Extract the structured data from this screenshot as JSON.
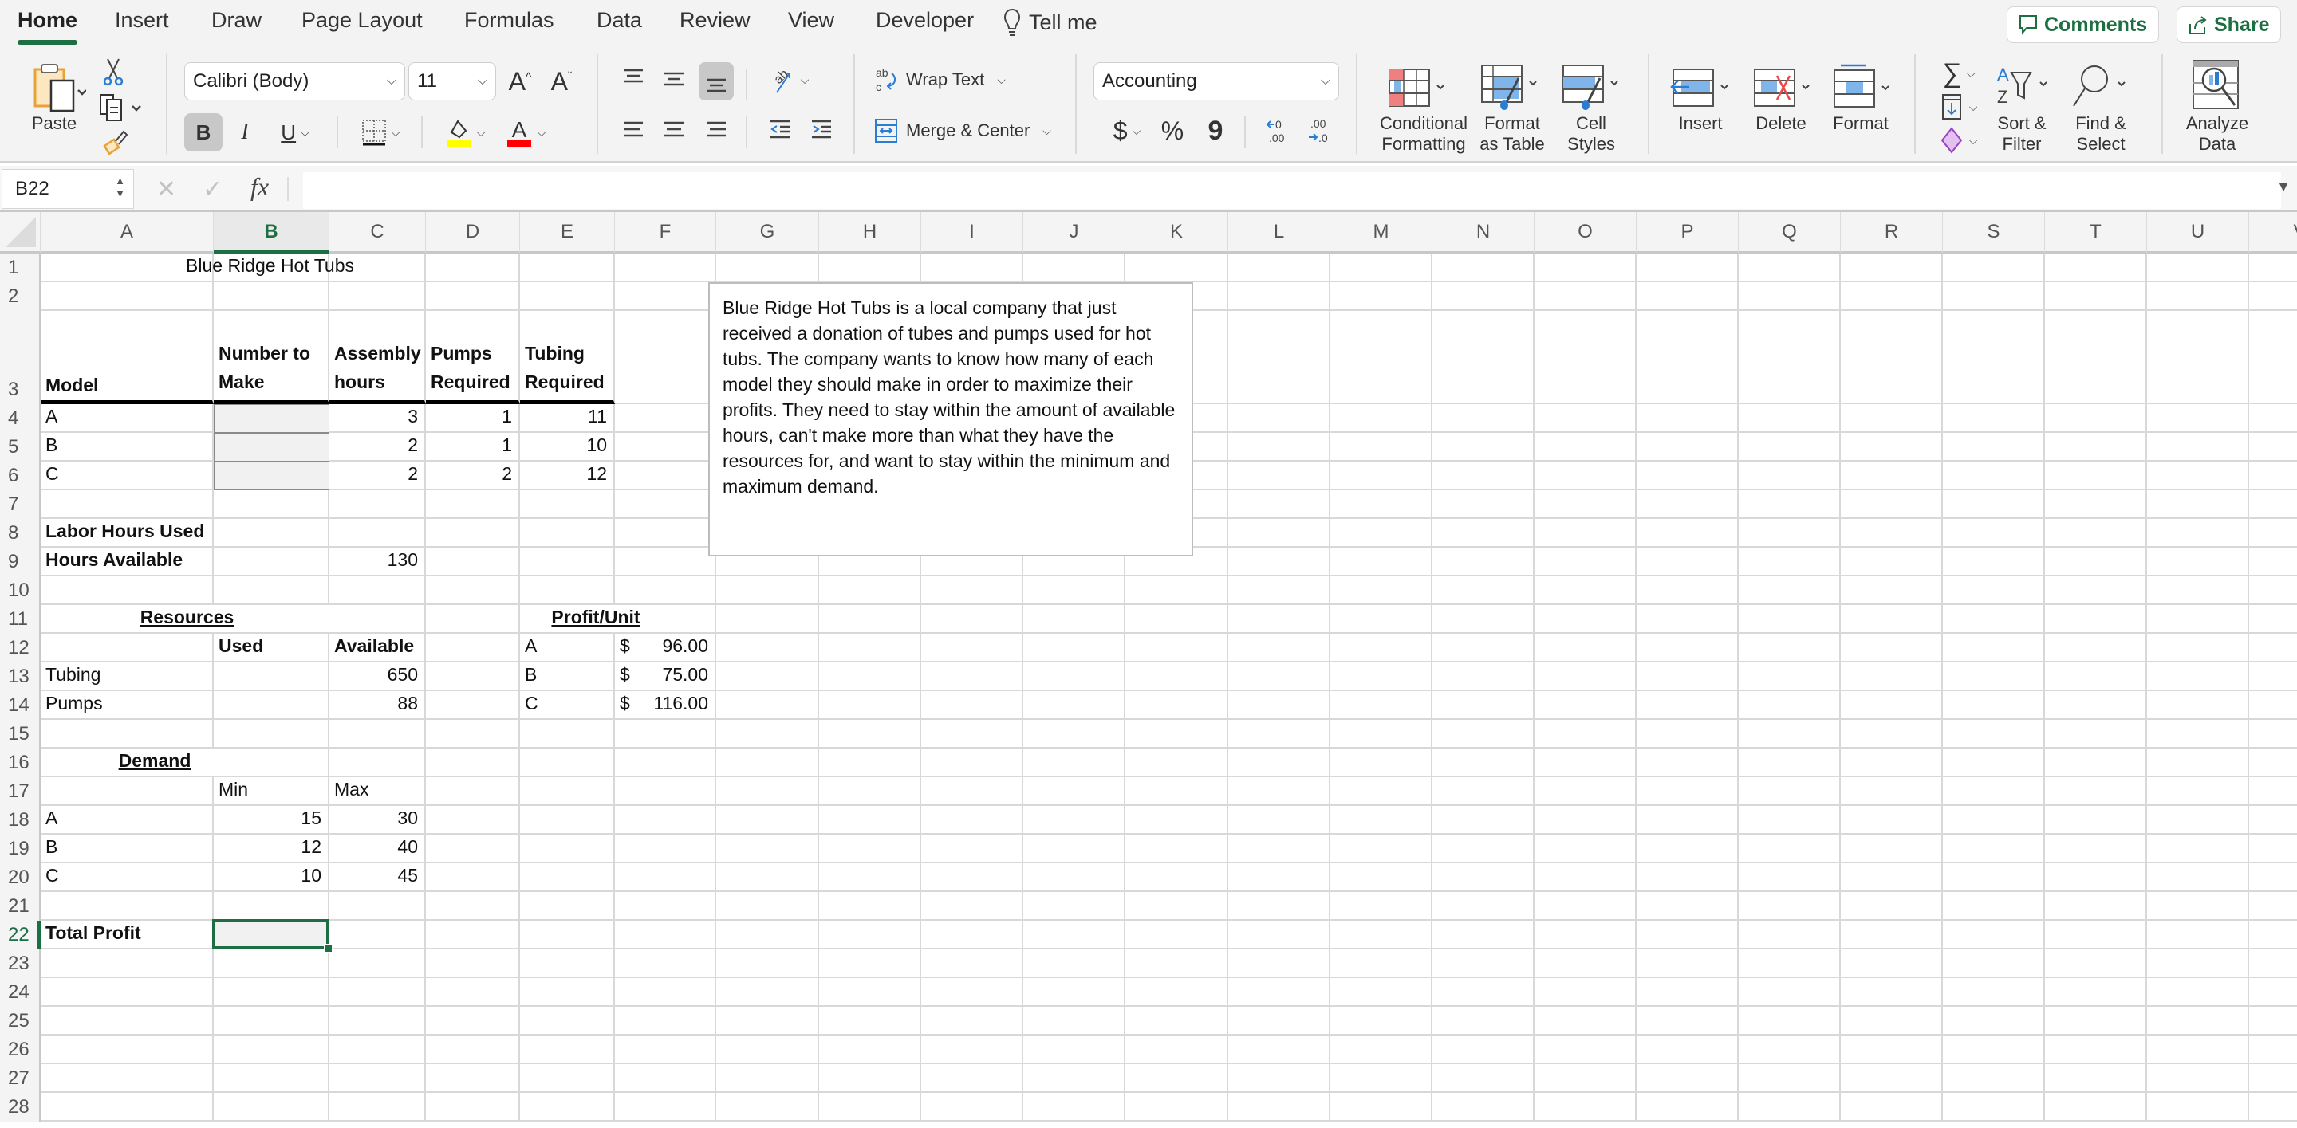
{
  "tabs": [
    {
      "label": "Home",
      "active": true
    },
    {
      "label": "Insert"
    },
    {
      "label": "Draw"
    },
    {
      "label": "Page Layout"
    },
    {
      "label": "Formulas"
    },
    {
      "label": "Data"
    },
    {
      "label": "Review"
    },
    {
      "label": "View"
    },
    {
      "label": "Developer"
    }
  ],
  "tell_me": "Tell me",
  "comments_label": "Comments",
  "share_label": "Share",
  "ribbon": {
    "paste_label": "Paste",
    "font_name": "Calibri (Body)",
    "font_size": "11",
    "bold": "B",
    "italic": "I",
    "underline": "U",
    "wrap_text": "Wrap Text",
    "merge_center": "Merge & Center",
    "number_format": "Accounting",
    "currency": "$",
    "percent": "%",
    "comma": "9",
    "conditional_formatting": [
      "Conditional",
      "Formatting"
    ],
    "format_as_table": [
      "Format",
      "as Table"
    ],
    "cell_styles": [
      "Cell",
      "Styles"
    ],
    "insert": "Insert",
    "delete": "Delete",
    "format": "Format",
    "sort_filter": [
      "Sort &",
      "Filter"
    ],
    "find_select": [
      "Find &",
      "Select"
    ],
    "analyze_data": [
      "Analyze",
      "Data"
    ],
    "accent_color": "#1e6e43",
    "highlight_color": "#ffff00",
    "font_color": "#ff0000"
  },
  "formula_bar": {
    "name_box": "B22",
    "fx": "fx",
    "content": ""
  },
  "columns": [
    "A",
    "B",
    "C",
    "D",
    "E",
    "F",
    "G",
    "H",
    "I",
    "J",
    "K",
    "L",
    "M",
    "N",
    "O",
    "P",
    "Q",
    "R",
    "S",
    "T",
    "U",
    "V"
  ],
  "selected_column": "B",
  "rows": [
    "1",
    "2",
    "3",
    "4",
    "5",
    "6",
    "7",
    "8",
    "9",
    "10",
    "11",
    "12",
    "13",
    "14",
    "15",
    "16",
    "17",
    "18",
    "19",
    "20",
    "21",
    "22",
    "23",
    "24",
    "25",
    "26",
    "27",
    "28"
  ],
  "selected_row": "22",
  "sheet": {
    "title": "Blue Ridge Hot Tubs",
    "header": {
      "model": "Model",
      "number_to_make": "Number to Make",
      "assembly_hours": "Assembly hours",
      "pumps_required": "Pumps Required",
      "tubing_required": "Tubing Required"
    },
    "models": [
      {
        "name": "A",
        "number_to_make": "",
        "assembly_hours": "3",
        "pumps": "1",
        "tubing": "11"
      },
      {
        "name": "B",
        "number_to_make": "",
        "assembly_hours": "2",
        "pumps": "1",
        "tubing": "10"
      },
      {
        "name": "C",
        "number_to_make": "",
        "assembly_hours": "2",
        "pumps": "2",
        "tubing": "12"
      }
    ],
    "labor_hours_used": "Labor Hours Used",
    "hours_available_label": "Hours Available",
    "hours_available": "130",
    "resources": {
      "title": "Resources",
      "used": "Used",
      "available": "Available",
      "items": [
        {
          "name": "Tubing",
          "used": "",
          "available": "650"
        },
        {
          "name": "Pumps",
          "used": "",
          "available": "88"
        }
      ]
    },
    "profit": {
      "title": "Profit/Unit",
      "items": [
        {
          "model": "A",
          "currency": "$",
          "value": "96.00"
        },
        {
          "model": "B",
          "currency": "$",
          "value": "75.00"
        },
        {
          "model": "C",
          "currency": "$",
          "value": "116.00"
        }
      ]
    },
    "demand": {
      "title": "Demand",
      "min": "Min",
      "max": "Max",
      "items": [
        {
          "model": "A",
          "min": "15",
          "max": "30"
        },
        {
          "model": "B",
          "min": "12",
          "max": "40"
        },
        {
          "model": "C",
          "min": "10",
          "max": "45"
        }
      ]
    },
    "total_profit_label": "Total Profit",
    "total_profit": ""
  },
  "textbox": "Blue Ridge Hot Tubs is a local company that just received a donation of tubes and pumps used for hot tubs. The company wants to know how many of each model they should make in order to maximize their profits. They need to stay within the amount of available hours, can't make more than what they have the resources for, and want to stay within the minimum and maximum demand."
}
